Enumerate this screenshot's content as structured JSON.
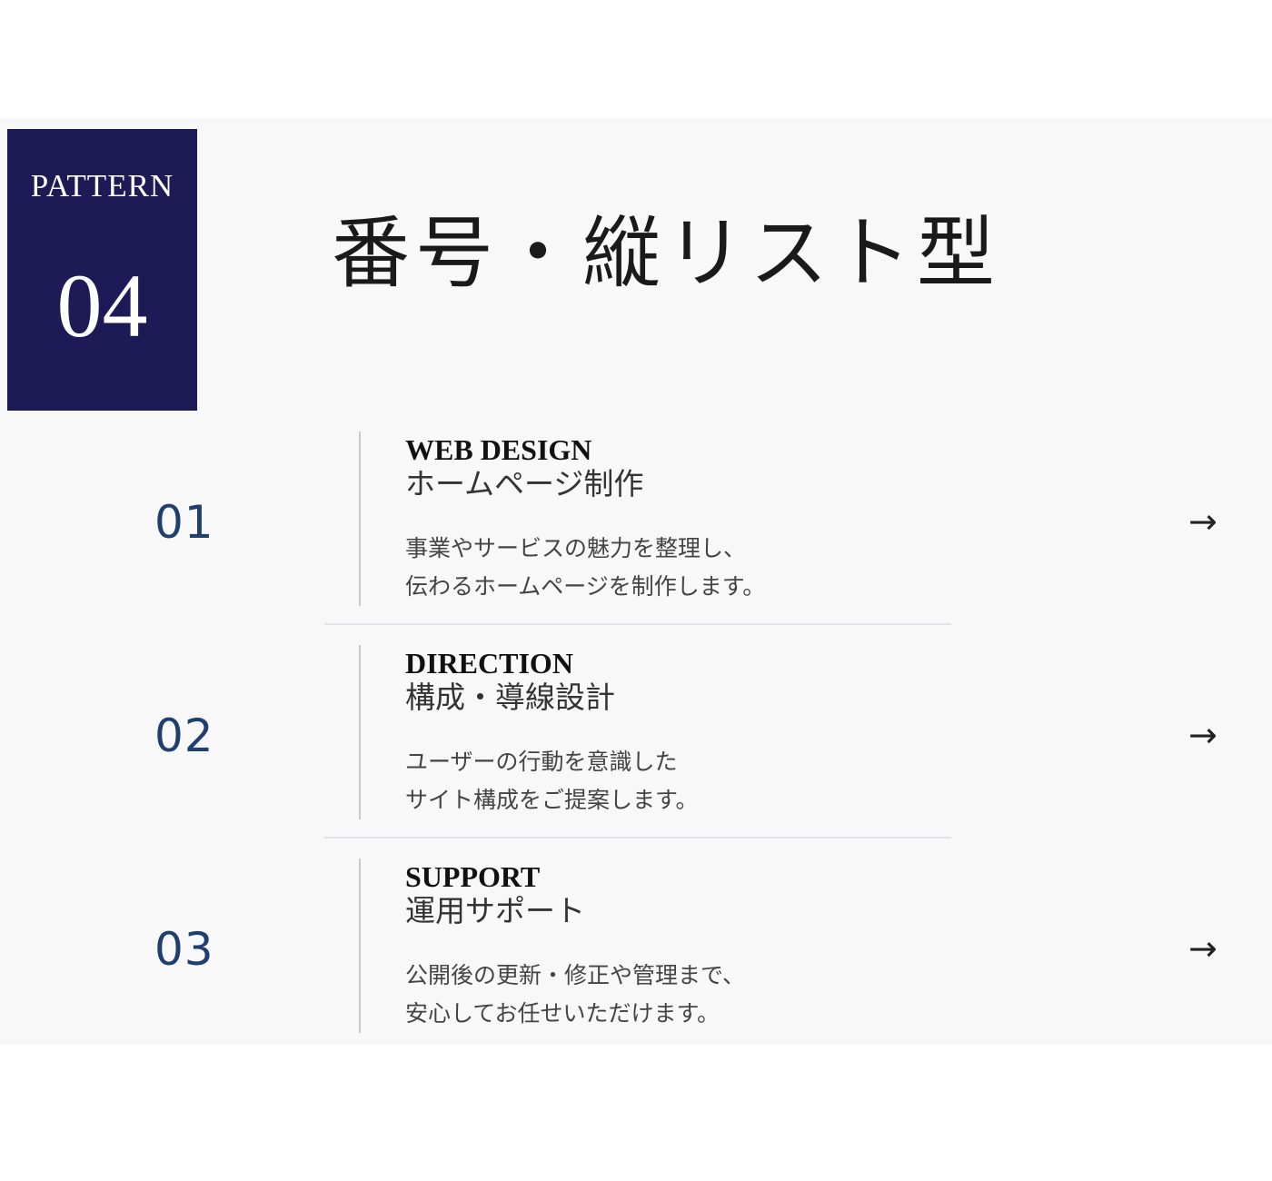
{
  "colors": {
    "badge_bg": "#1e1a55",
    "number": "#1f3f6e",
    "section_bg": "#f8f8f8"
  },
  "badge": {
    "label": "PATTERN",
    "number": "04"
  },
  "title": "番号・縦リスト型",
  "items": [
    {
      "number": "01",
      "en": "WEB DESIGN",
      "jp": "ホームページ制作",
      "desc": [
        "事業やサービスの魅力を整理し、",
        "伝わるホームページを制作します。"
      ],
      "arrow": "→"
    },
    {
      "number": "02",
      "en": "DIRECTION",
      "jp": "構成・導線設計",
      "desc": [
        "ユーザーの行動を意識した",
        "サイト構成をご提案します。"
      ],
      "arrow": "→"
    },
    {
      "number": "03",
      "en": "SUPPORT",
      "jp": "運用サポート",
      "desc": [
        "公開後の更新・修正や管理まで、",
        "安心してお任せいただけます。"
      ],
      "arrow": "→"
    }
  ]
}
